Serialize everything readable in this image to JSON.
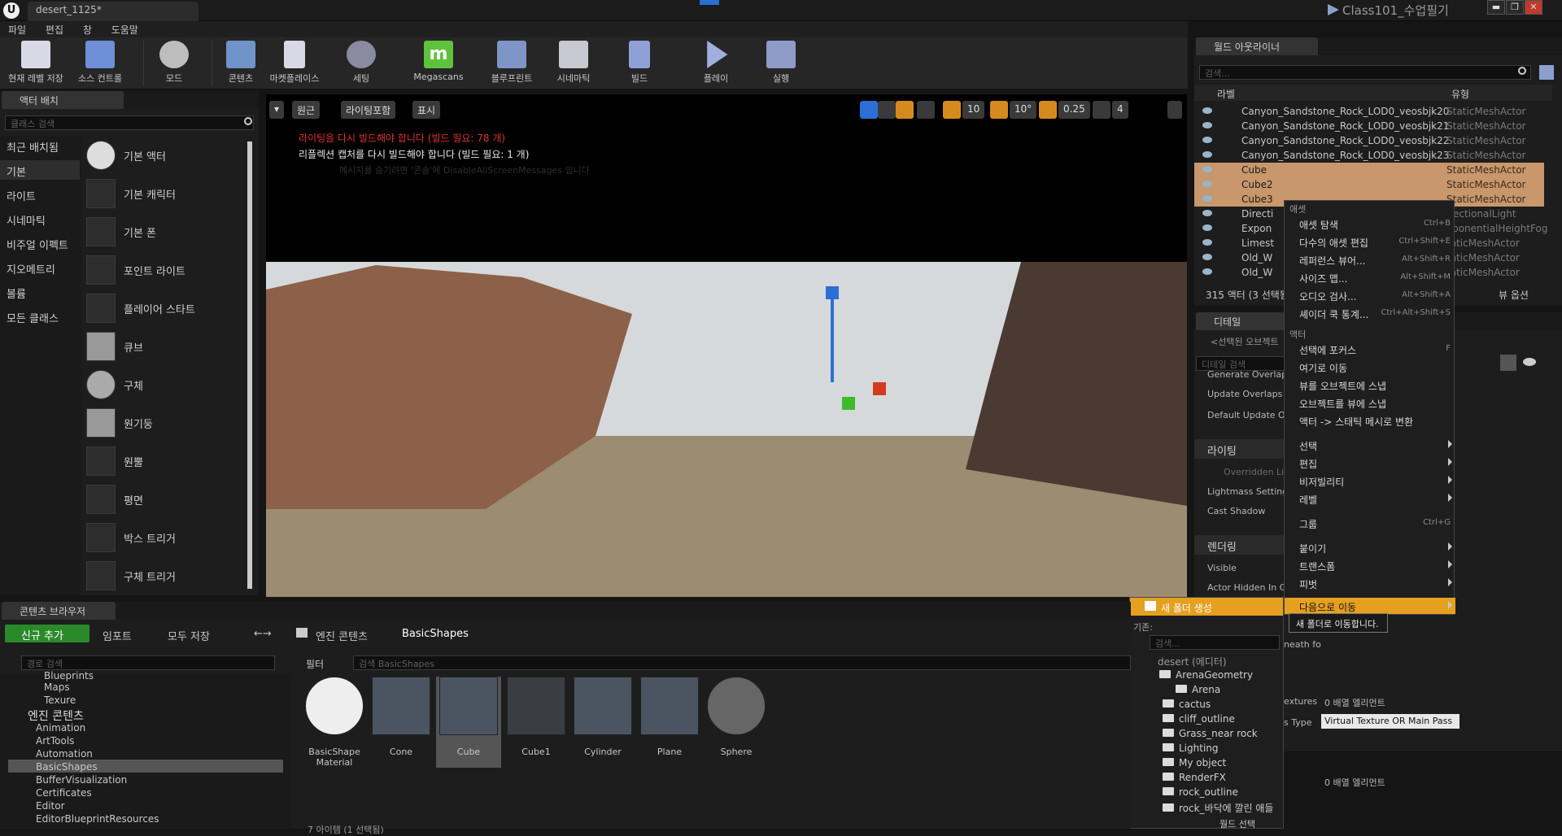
{
  "titlebar": {
    "doc_tab": "desert_1125*",
    "project": "Class101_수업필기",
    "btn_min": "▬",
    "btn_max": "❐",
    "btn_close": "✕"
  },
  "menu": [
    "파일",
    "편집",
    "창",
    "도움말"
  ],
  "toolbar": [
    {
      "label": "현재 레벨 저장",
      "icon": "save-icon",
      "color": "#d8d8e6"
    },
    {
      "label": "소스 컨트롤",
      "icon": "source-control-icon",
      "color": "#6f8fd8"
    },
    {
      "label": "모드",
      "icon": "modes-icon",
      "color": "#cfcfcf"
    },
    {
      "label": "콘텐츠",
      "icon": "content-icon",
      "color": "#6f95c8"
    },
    {
      "label": "마켓플레이스",
      "icon": "marketplace-icon",
      "color": "#d8d8e6"
    },
    {
      "label": "세팅",
      "icon": "settings-icon",
      "color": "#9090a8"
    },
    {
      "label": "Megascans",
      "icon": "megascans-icon",
      "color": "#5fc23d"
    },
    {
      "label": "블루프린트",
      "icon": "blueprint-icon",
      "color": "#7f95c8"
    },
    {
      "label": "시네마틱",
      "icon": "cinematics-icon",
      "color": "#c8c8d0"
    },
    {
      "label": "빌드",
      "icon": "build-icon",
      "color": "#8fa0d8"
    },
    {
      "label": "플레이",
      "icon": "play-icon",
      "color": "#a0aee0"
    },
    {
      "label": "실행",
      "icon": "launch-icon",
      "color": "#8f9cc8"
    }
  ],
  "place_actors": {
    "tab": "액터 배치",
    "search_placeholder": "클래스 검색",
    "categories": [
      "최근 배치됨",
      "기본",
      "라이트",
      "시네마틱",
      "비주얼 이펙트",
      "지오메트리",
      "볼륨",
      "모든 클래스"
    ],
    "selected_category": "기본",
    "items": [
      "기본 액터",
      "기본 캐릭터",
      "기본 폰",
      "포인트 라이트",
      "플레이어 스타트",
      "큐브",
      "구체",
      "원기둥",
      "원뿔",
      "평면",
      "박스 트리거",
      "구체 트리거"
    ]
  },
  "viewport": {
    "btn_perspective": "원근",
    "btn_lighting": "라이팅포함",
    "btn_show": "표시",
    "grid": "10",
    "rot": "10°",
    "scale": "0.25",
    "cam_speed": "4",
    "msg_lighting": "라이팅을 다시 빌드해야 합니다 (빌드 필요: 78 개)",
    "msg_reflection": "리플렉션 캡처를 다시 빌드해야 합니다 (빌드 필요: 1 개)",
    "msg_hint": "메시지를 숨기려면 '콘솔'에 DisableAllScreenMessages 입니다"
  },
  "outliner": {
    "tab": "월드 아웃라이너",
    "search_placeholder": "검색...",
    "col_label": "라벨",
    "col_type": "유형",
    "rows": [
      {
        "name": "Canyon_Sandstone_Rock_LOD0_veosbjk20",
        "type": "StaticMeshActor",
        "sel": false
      },
      {
        "name": "Canyon_Sandstone_Rock_LOD0_veosbjk21",
        "type": "StaticMeshActor",
        "sel": false
      },
      {
        "name": "Canyon_Sandstone_Rock_LOD0_veosbjk22",
        "type": "StaticMeshActor",
        "sel": false
      },
      {
        "name": "Canyon_Sandstone_Rock_LOD0_veosbjk23",
        "type": "StaticMeshActor",
        "sel": false
      },
      {
        "name": "Cube",
        "type": "StaticMeshActor",
        "sel": true
      },
      {
        "name": "Cube2",
        "type": "StaticMeshActor",
        "sel": true
      },
      {
        "name": "Cube3",
        "type": "StaticMeshActor",
        "sel": true
      },
      {
        "name": "Directi",
        "type": "irectionalLight",
        "sel": false
      },
      {
        "name": "Expon",
        "type": "xponentialHeightFog",
        "sel": false
      },
      {
        "name": "Limest",
        "type": "taticMeshActor",
        "sel": false
      },
      {
        "name": "Old_W",
        "type": "taticMeshActor",
        "sel": false
      },
      {
        "name": "Old_W",
        "type": "taticMeshActor",
        "sel": false
      }
    ],
    "count": "315 액터 (3 선택됨)",
    "view_options": "뷰 옵션"
  },
  "details": {
    "tab": "디테일",
    "selected": "<선택된 오브젝트",
    "search_placeholder": "디테일 검색",
    "rows": [
      "Generate Overlap E",
      "Update Overlaps M",
      "Default Update Ov"
    ],
    "section_lighting": "라이팅",
    "lighting_rows": [
      "Overridden Lig",
      "Lightmass Setting",
      "Cast Shadow"
    ],
    "section_rendering": "렌더링",
    "rendering_rows": [
      "Visible",
      "Actor Hidden In Ga"
    ],
    "extra1": "neath fo",
    "textures_label": "extures",
    "textures_value": "0 배열 엘리먼트",
    "vt_label": "s Type",
    "vt_value": "Virtual Texture OR Main Pass",
    "array2_value": "0 배열 엘리먼트"
  },
  "context_menu": {
    "asset_header": "애셋",
    "asset_items": [
      {
        "label": "애셋 탐색",
        "sc": "Ctrl+B"
      },
      {
        "label": "다수의 애셋 편집",
        "sc": "Ctrl+Shift+E"
      },
      {
        "label": "레퍼런스 뷰어...",
        "sc": "Alt+Shift+R"
      },
      {
        "label": "사이즈 맵...",
        "sc": "Alt+Shift+M"
      },
      {
        "label": "오디오 검사...",
        "sc": "Alt+Shift+A"
      },
      {
        "label": "셰이더 쿡 통계...",
        "sc": "Ctrl+Alt+Shift+S"
      }
    ],
    "actor_header": "액터",
    "actor_items": [
      {
        "label": "선택에 포커스",
        "sc": "F"
      },
      {
        "label": "여기로 이동",
        "sc": ""
      },
      {
        "label": "뷰를 오브젝트에 스냅",
        "sc": ""
      },
      {
        "label": "오브젝트를 뷰에 스냅",
        "sc": ""
      },
      {
        "label": "액터 -> 스태틱 메시로 변환",
        "sc": ""
      }
    ],
    "sub_items": [
      "선택",
      "편집",
      "비저빌리티",
      "레벨"
    ],
    "group": {
      "label": "그룹",
      "sc": "Ctrl+G"
    },
    "sub_items2": [
      "붙이기",
      "트랜스폼",
      "피벗"
    ],
    "move_to": "다음으로 이동",
    "tooltip": "새 폴더로 이동합니다."
  },
  "folder_menu": {
    "new_folder": "새 폴더 생성",
    "root_label": "기존:",
    "search_placeholder": "검색...",
    "tree": [
      "desert (에디터)",
      "ArenaGeometry",
      "Arena",
      "cactus",
      "cliff_outline",
      "Grass_near rock",
      "Lighting",
      "My object",
      "RenderFX",
      "rock_outline",
      "rock_바닥에 깔린 애들"
    ],
    "bottom": "월드 선택"
  },
  "content_browser": {
    "tab": "콘텐츠 브라우저",
    "add_new": "신규 추가",
    "import": "임포트",
    "save_all": "모두 저장",
    "path_root": "엔진 콘텐츠",
    "path_leaf": "BasicShapes",
    "path_search_placeholder": "경로 검색",
    "filter": "필터",
    "asset_search_placeholder": "검색 BasicShapes",
    "tree": [
      "Blueprints",
      "Maps",
      "Texure",
      "엔진 콘텐츠",
      "Animation",
      "ArtTools",
      "Automation",
      "BasicShapes",
      "BufferVisualization",
      "Certificates",
      "Editor",
      "EditorBlueprintResources"
    ],
    "assets": [
      "BasicShape Material",
      "Cone",
      "Cube",
      "Cube1",
      "Cylinder",
      "Plane",
      "Sphere"
    ],
    "status": "7 아이템 (1 선택됨)"
  }
}
